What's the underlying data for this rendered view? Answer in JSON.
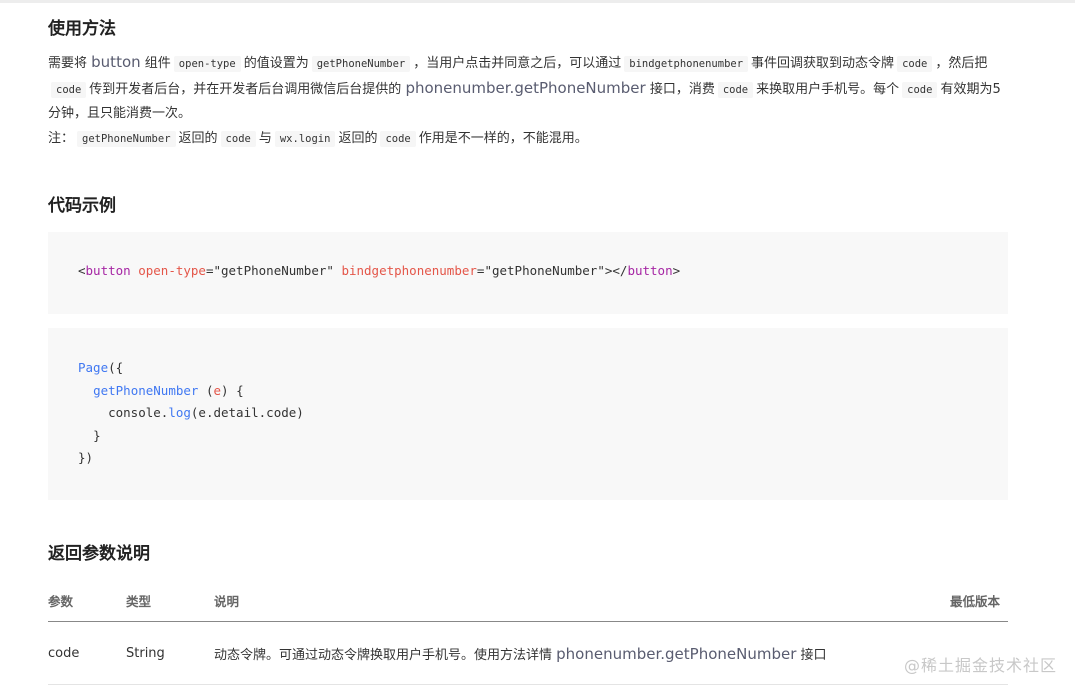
{
  "usage": {
    "title": "使用方法",
    "p1": {
      "t1": "需要将",
      "button_word": "button",
      "t2": "组件",
      "code_open_type": "open-type",
      "t3": "的值设置为",
      "code_getPhoneNumber": "getPhoneNumber",
      "t4": "，当用户点击并同意之后，可以通过",
      "code_bind": "bindgetphonenumber",
      "t5": "事件回调获取到动态令牌",
      "code_code1": "code",
      "t6": "，然后把",
      "code_code2": "code",
      "t7": "传到开发者后台，并在开发者后台调用微信后台提供的",
      "api_link": "phonenumber.getPhoneNumber",
      "t8": "接口，消费",
      "code_code3": "code",
      "t9": "来换取用户手机号。每个",
      "code_code4": "code",
      "t10": "有效期为5分钟，且只能消费一次。"
    },
    "p2": {
      "t1": "注：",
      "code_getPhoneNumber": "getPhoneNumber",
      "t2": "返回的",
      "code_code": "code",
      "t3": "与",
      "code_wxlogin": "wx.login",
      "t4": "返回的",
      "code_code2": "code",
      "t5": "作用是不一样的，不能混用。"
    }
  },
  "example": {
    "title": "代码示例",
    "wxml": {
      "open": "<",
      "tag": "button",
      "attr1": "open-type",
      "eq1": "=",
      "val1": "\"getPhoneNumber\"",
      "attr2": "bindgetphonenumber",
      "eq2": "=",
      "val2": "\"getPhoneNumber\"",
      "close": "></",
      "tag2": "button",
      "end": ">"
    },
    "js": {
      "l1_fn": "Page",
      "l1_rest": "({",
      "l2_fn": "getPhoneNumber",
      "l2_open": " (",
      "l2_param": "e",
      "l2_close": ") {",
      "l3_obj": "console.",
      "l3_fn": "log",
      "l3_rest": "(e.detail.code)",
      "l4": "}",
      "l5": "})"
    }
  },
  "returns": {
    "title": "返回参数说明",
    "headers": [
      "参数",
      "类型",
      "说明",
      "最低版本"
    ],
    "rows": [
      {
        "name": "code",
        "type": "String",
        "desc_text": "动态令牌。可通过动态令牌换取用户手机号。使用方法详情",
        "desc_link": "phonenumber.getPhoneNumber",
        "desc_tail": "接口",
        "version": ""
      }
    ]
  },
  "watermark": "@稀土掘金技术社区"
}
